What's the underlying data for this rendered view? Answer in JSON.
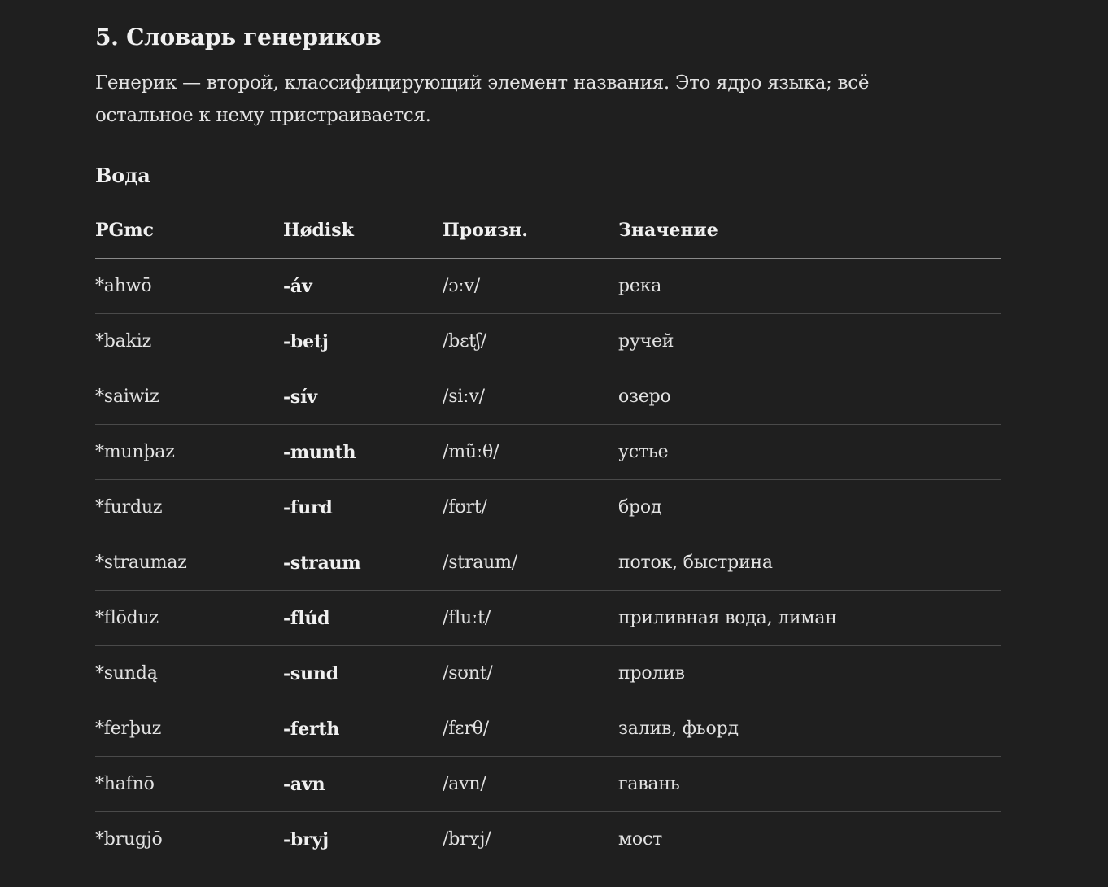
{
  "section": {
    "title": "5. Словарь генериков",
    "intro": "Генерик — второй, классифицирующий элемент названия. Это ядро языка; всё остальное к нему пристраивается."
  },
  "group": {
    "title": "Вода"
  },
  "table": {
    "headers": [
      "PGmc",
      "Hødisk",
      "Произн.",
      "Значение"
    ],
    "rows": [
      {
        "pgmc": "*ahwō",
        "hodisk": "-áv",
        "pron": "/ɔːv/",
        "meaning": "река"
      },
      {
        "pgmc": "*bakiz",
        "hodisk": "-betj",
        "pron": "/bɛtʃ/",
        "meaning": "ручей"
      },
      {
        "pgmc": "*saiwiz",
        "hodisk": "-sív",
        "pron": "/siːv/",
        "meaning": "озеро"
      },
      {
        "pgmc": "*munþaz",
        "hodisk": "-munth",
        "pron": "/mũːθ/",
        "meaning": "устье"
      },
      {
        "pgmc": "*furduz",
        "hodisk": "-furd",
        "pron": "/fʊrt/",
        "meaning": "брод"
      },
      {
        "pgmc": "*straumaz",
        "hodisk": "-straum",
        "pron": "/straum/",
        "meaning": "поток, быстрина"
      },
      {
        "pgmc": "*flōduz",
        "hodisk": "-flúd",
        "pron": "/fluːt/",
        "meaning": "приливная вода, лиман"
      },
      {
        "pgmc": "*sundą",
        "hodisk": "-sund",
        "pron": "/sʊnt/",
        "meaning": "пролив"
      },
      {
        "pgmc": "*ferþuz",
        "hodisk": "-ferth",
        "pron": "/fɛrθ/",
        "meaning": "залив, фьорд"
      },
      {
        "pgmc": "*hafnō",
        "hodisk": "-avn",
        "pron": "/avn/",
        "meaning": "гавань"
      },
      {
        "pgmc": "*brugjō",
        "hodisk": "-bryj",
        "pron": "/brʏj/",
        "meaning": "мост"
      }
    ]
  }
}
